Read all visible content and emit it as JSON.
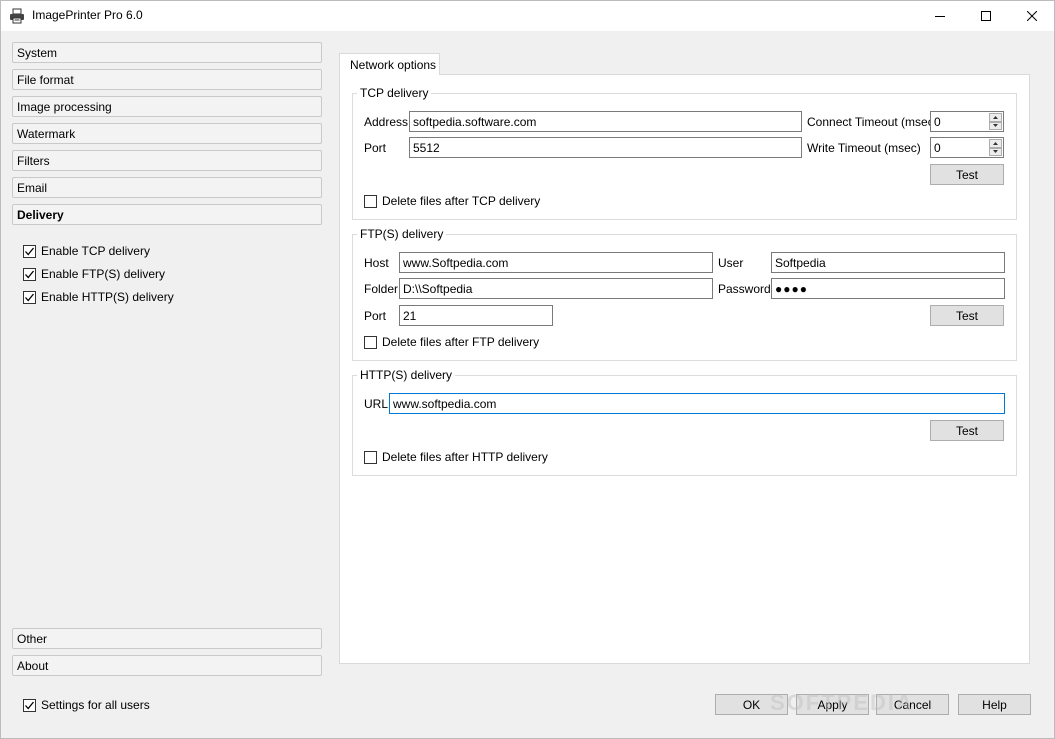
{
  "window": {
    "title": "ImagePrinter Pro 6.0"
  },
  "nav": {
    "top_items": [
      "System",
      "File format",
      "Image processing",
      "Watermark",
      "Filters",
      "Email",
      "Delivery"
    ],
    "active": "Delivery",
    "bottom_items": [
      "Other",
      "About"
    ]
  },
  "delivery_options": [
    {
      "label": "Enable TCP delivery",
      "checked": true
    },
    {
      "label": "Enable FTP(S) delivery",
      "checked": true
    },
    {
      "label": "Enable HTTP(S) delivery",
      "checked": true
    }
  ],
  "settings_all_users": {
    "label": "Settings for all users",
    "checked": true
  },
  "tab": {
    "label": "Network options"
  },
  "tcp": {
    "title": "TCP delivery",
    "address_label": "Address",
    "address_value": "softpedia.software.com",
    "port_label": "Port",
    "port_value": "5512",
    "connect_timeout_label": "Connect Timeout (msec)",
    "connect_timeout_value": "0",
    "write_timeout_label": "Write Timeout (msec)",
    "write_timeout_value": "0",
    "test_label": "Test",
    "delete_label": "Delete files after TCP delivery",
    "delete_checked": false
  },
  "ftp": {
    "title": "FTP(S) delivery",
    "host_label": "Host",
    "host_value": "www.Softpedia.com",
    "user_label": "User",
    "user_value": "Softpedia",
    "folder_label": "Folder",
    "folder_value": "D:\\\\Softpedia",
    "password_label": "Password",
    "password_value": "●●●●",
    "port_label": "Port",
    "port_value": "21",
    "test_label": "Test",
    "delete_label": "Delete files after FTP delivery",
    "delete_checked": false
  },
  "http": {
    "title": "HTTP(S) delivery",
    "url_label": "URL",
    "url_value": "www.softpedia.com",
    "test_label": "Test",
    "delete_label": "Delete files after HTTP delivery",
    "delete_checked": false
  },
  "footer": {
    "ok": "OK",
    "apply": "Apply",
    "cancel": "Cancel",
    "help": "Help"
  },
  "watermark_text": "SOFTPEDIA"
}
